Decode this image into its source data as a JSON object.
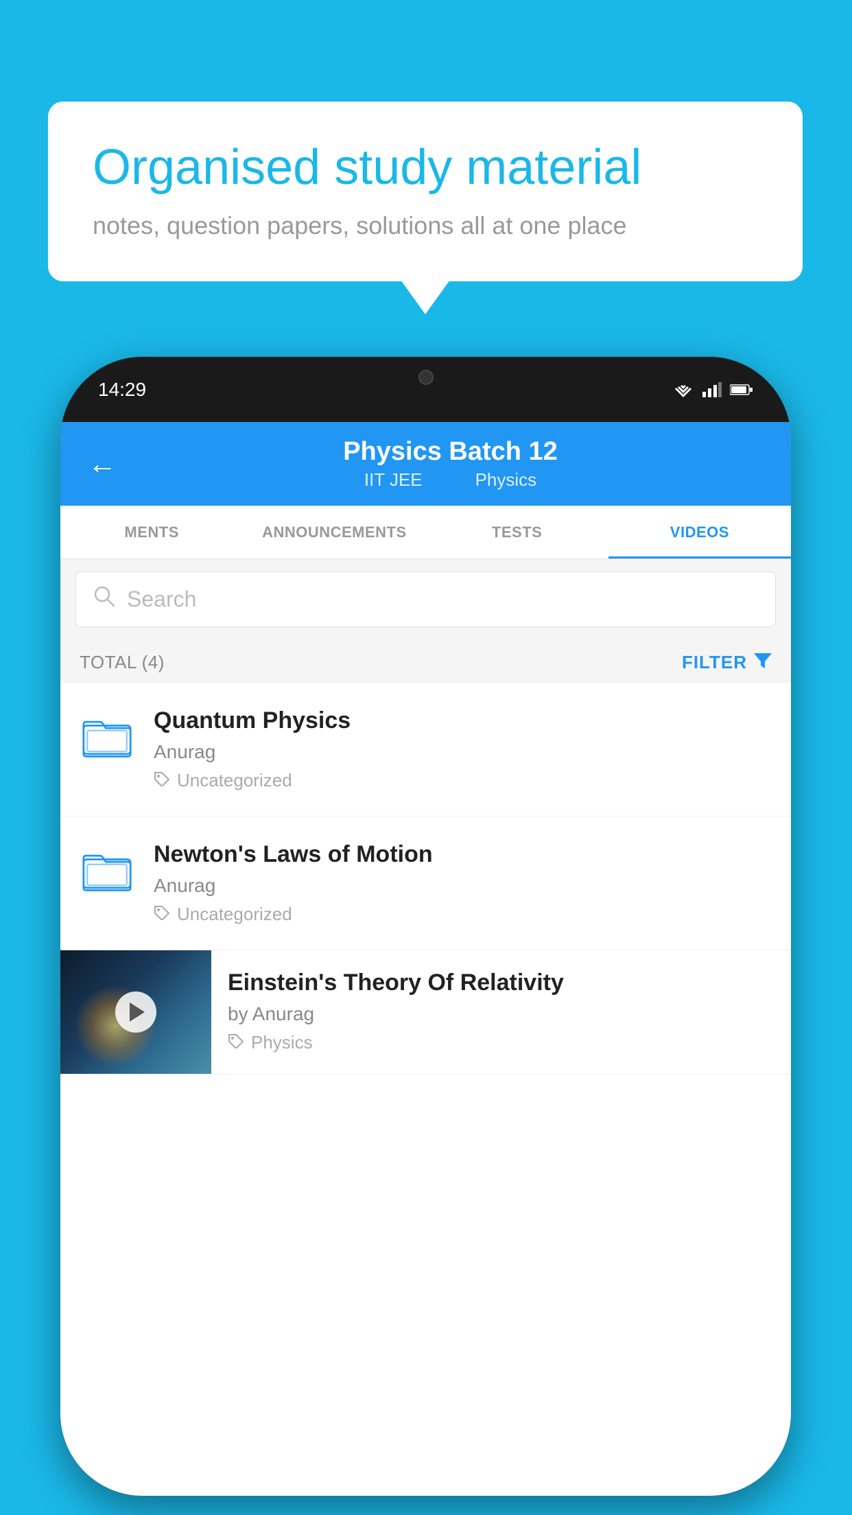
{
  "background_color": "#1ab8e8",
  "speech_bubble": {
    "title": "Organised study material",
    "subtitle": "notes, question papers, solutions all at one place"
  },
  "phone": {
    "status_bar": {
      "time": "14:29",
      "wifi": "▼▲",
      "signal": "▲",
      "battery": "▮"
    },
    "header": {
      "back_label": "←",
      "title": "Physics Batch 12",
      "subtitle_part1": "IIT JEE",
      "subtitle_part2": "Physics"
    },
    "tabs": [
      {
        "label": "MENTS",
        "active": false
      },
      {
        "label": "ANNOUNCEMENTS",
        "active": false
      },
      {
        "label": "TESTS",
        "active": false
      },
      {
        "label": "VIDEOS",
        "active": true
      }
    ],
    "search": {
      "placeholder": "Search"
    },
    "total_label": "TOTAL (4)",
    "filter_label": "FILTER",
    "items": [
      {
        "title": "Quantum Physics",
        "author": "Anurag",
        "tag": "Uncategorized",
        "has_thumbnail": false
      },
      {
        "title": "Newton's Laws of Motion",
        "author": "Anurag",
        "tag": "Uncategorized",
        "has_thumbnail": false
      },
      {
        "title": "Einstein's Theory Of Relativity",
        "author": "by Anurag",
        "tag": "Physics",
        "has_thumbnail": true
      }
    ]
  }
}
